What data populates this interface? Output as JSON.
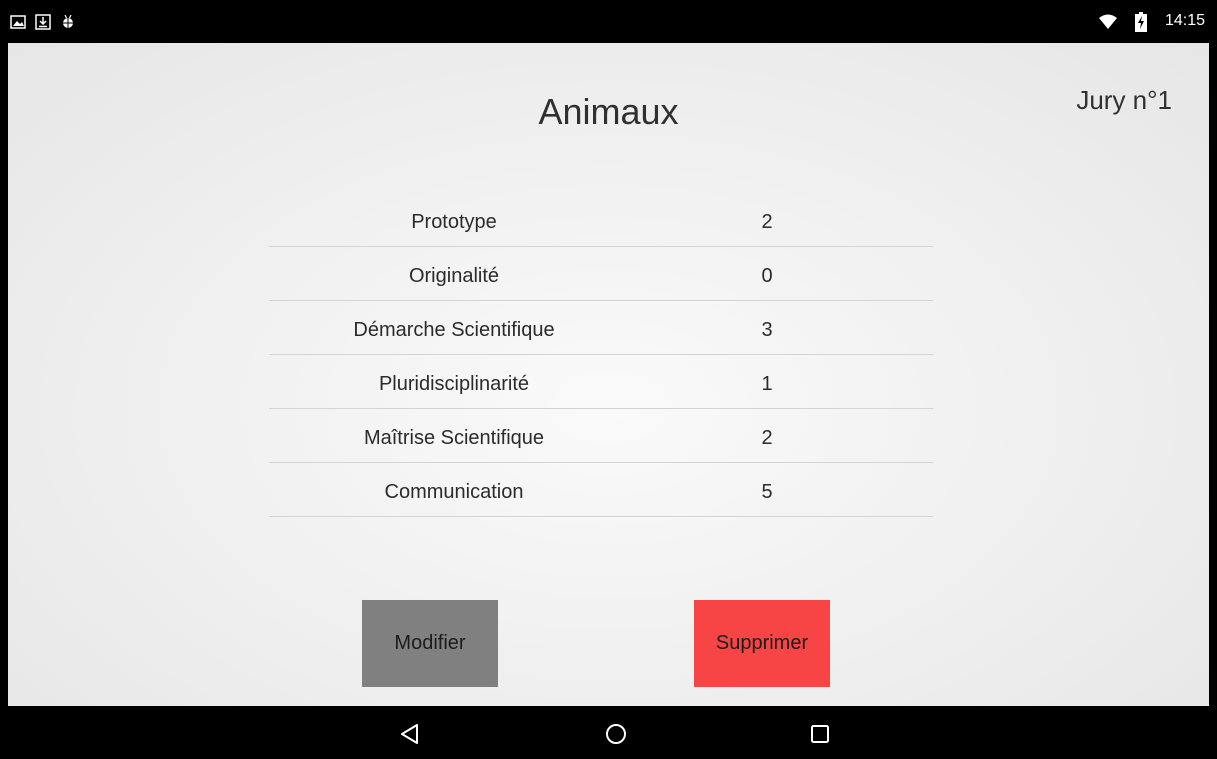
{
  "status_bar": {
    "time": "14:15",
    "notification_icons": [
      "image-notification-icon",
      "download-notification-icon",
      "android-debug-icon"
    ],
    "system_icons": [
      "wifi-icon",
      "battery-charging-icon"
    ]
  },
  "header": {
    "title": "Animaux",
    "jury": "Jury n°1"
  },
  "scores": [
    {
      "criterion": "Prototype",
      "value": "2"
    },
    {
      "criterion": "Originalité",
      "value": "0"
    },
    {
      "criterion": "Démarche Scientifique",
      "value": "3"
    },
    {
      "criterion": "Pluridisciplinarité",
      "value": "1"
    },
    {
      "criterion": "Maîtrise Scientifique",
      "value": "2"
    },
    {
      "criterion": "Communication",
      "value": "5"
    }
  ],
  "actions": {
    "modify_label": "Modifier",
    "delete_label": "Supprimer"
  },
  "nav_bar": {
    "icons": [
      "back-icon",
      "home-icon",
      "recents-icon"
    ]
  },
  "colors": {
    "modify_button": "#808080",
    "delete_button": "#f74444",
    "bars": "#000000"
  }
}
